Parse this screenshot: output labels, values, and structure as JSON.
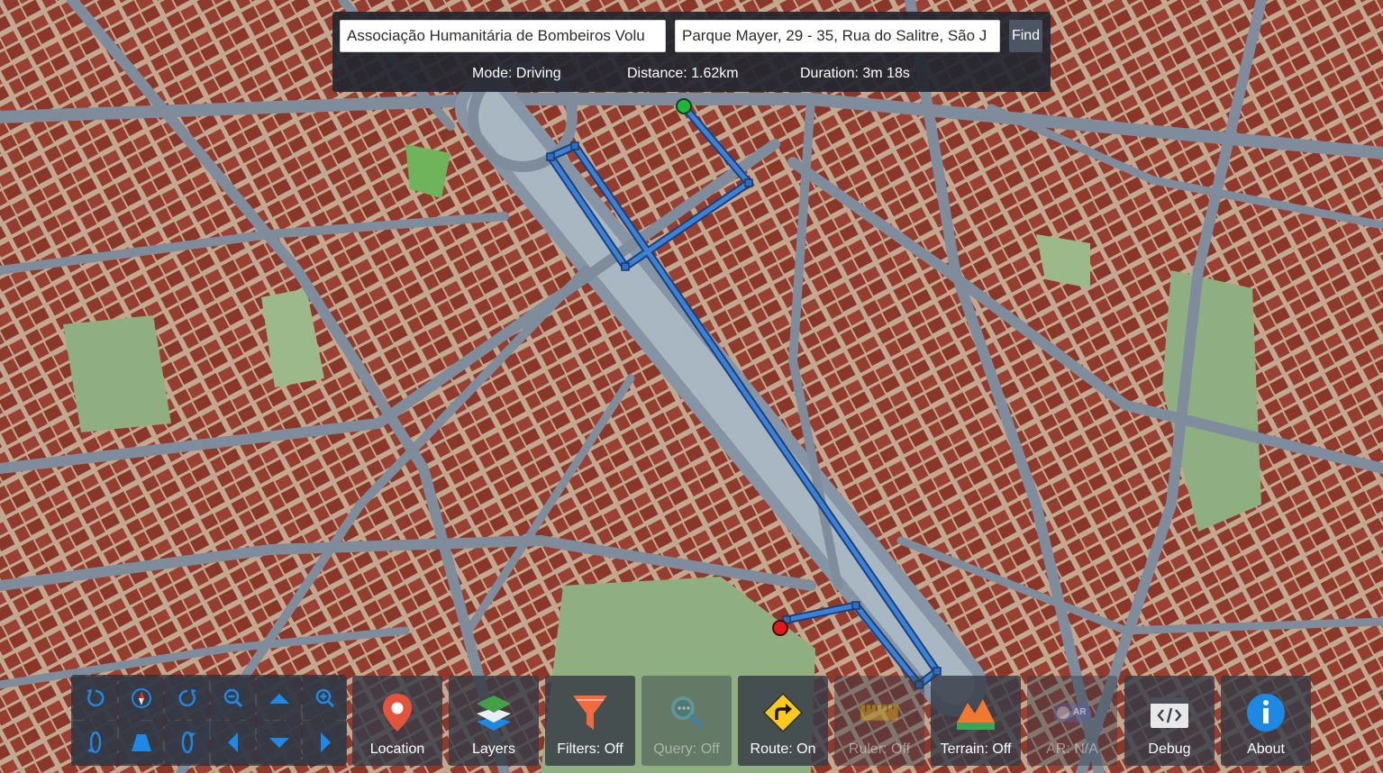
{
  "route": {
    "from": "Associação Humanitária de Bombeiros Volu",
    "to": "Parque Mayer, 29 - 35, Rua do Salitre, São J",
    "find_label": "Find",
    "mode": "Mode: Driving",
    "distance": "Distance: 1.62km",
    "duration": "Duration: 3m 18s"
  },
  "nav_controls": {
    "icons": [
      "rotate-left-icon",
      "compass-icon",
      "rotate-right-icon",
      "zoom-out-icon",
      "pan-up-icon",
      "zoom-in-icon",
      "tilt-left-icon",
      "tilt-perspective-icon",
      "tilt-right-icon",
      "pan-left-icon",
      "pan-down-icon",
      "pan-right-icon"
    ]
  },
  "toolbar": {
    "location": "Location",
    "layers": "Layers",
    "filters": "Filters: Off",
    "query": "Query: Off",
    "route": "Route: On",
    "ruler": "Ruler: Off",
    "terrain": "Terrain: Off",
    "ar": "AR: N/A",
    "ar_badge": "AR",
    "debug": "Debug",
    "about": "About"
  },
  "colors": {
    "building": "#8f3a2d",
    "road": "#7e8c9c",
    "route_line": "#2d6fc4",
    "start_marker": "#1fb53a",
    "end_marker": "#e01a1a",
    "panel_bg": "#232630",
    "accent_blue": "#1e88e5"
  }
}
